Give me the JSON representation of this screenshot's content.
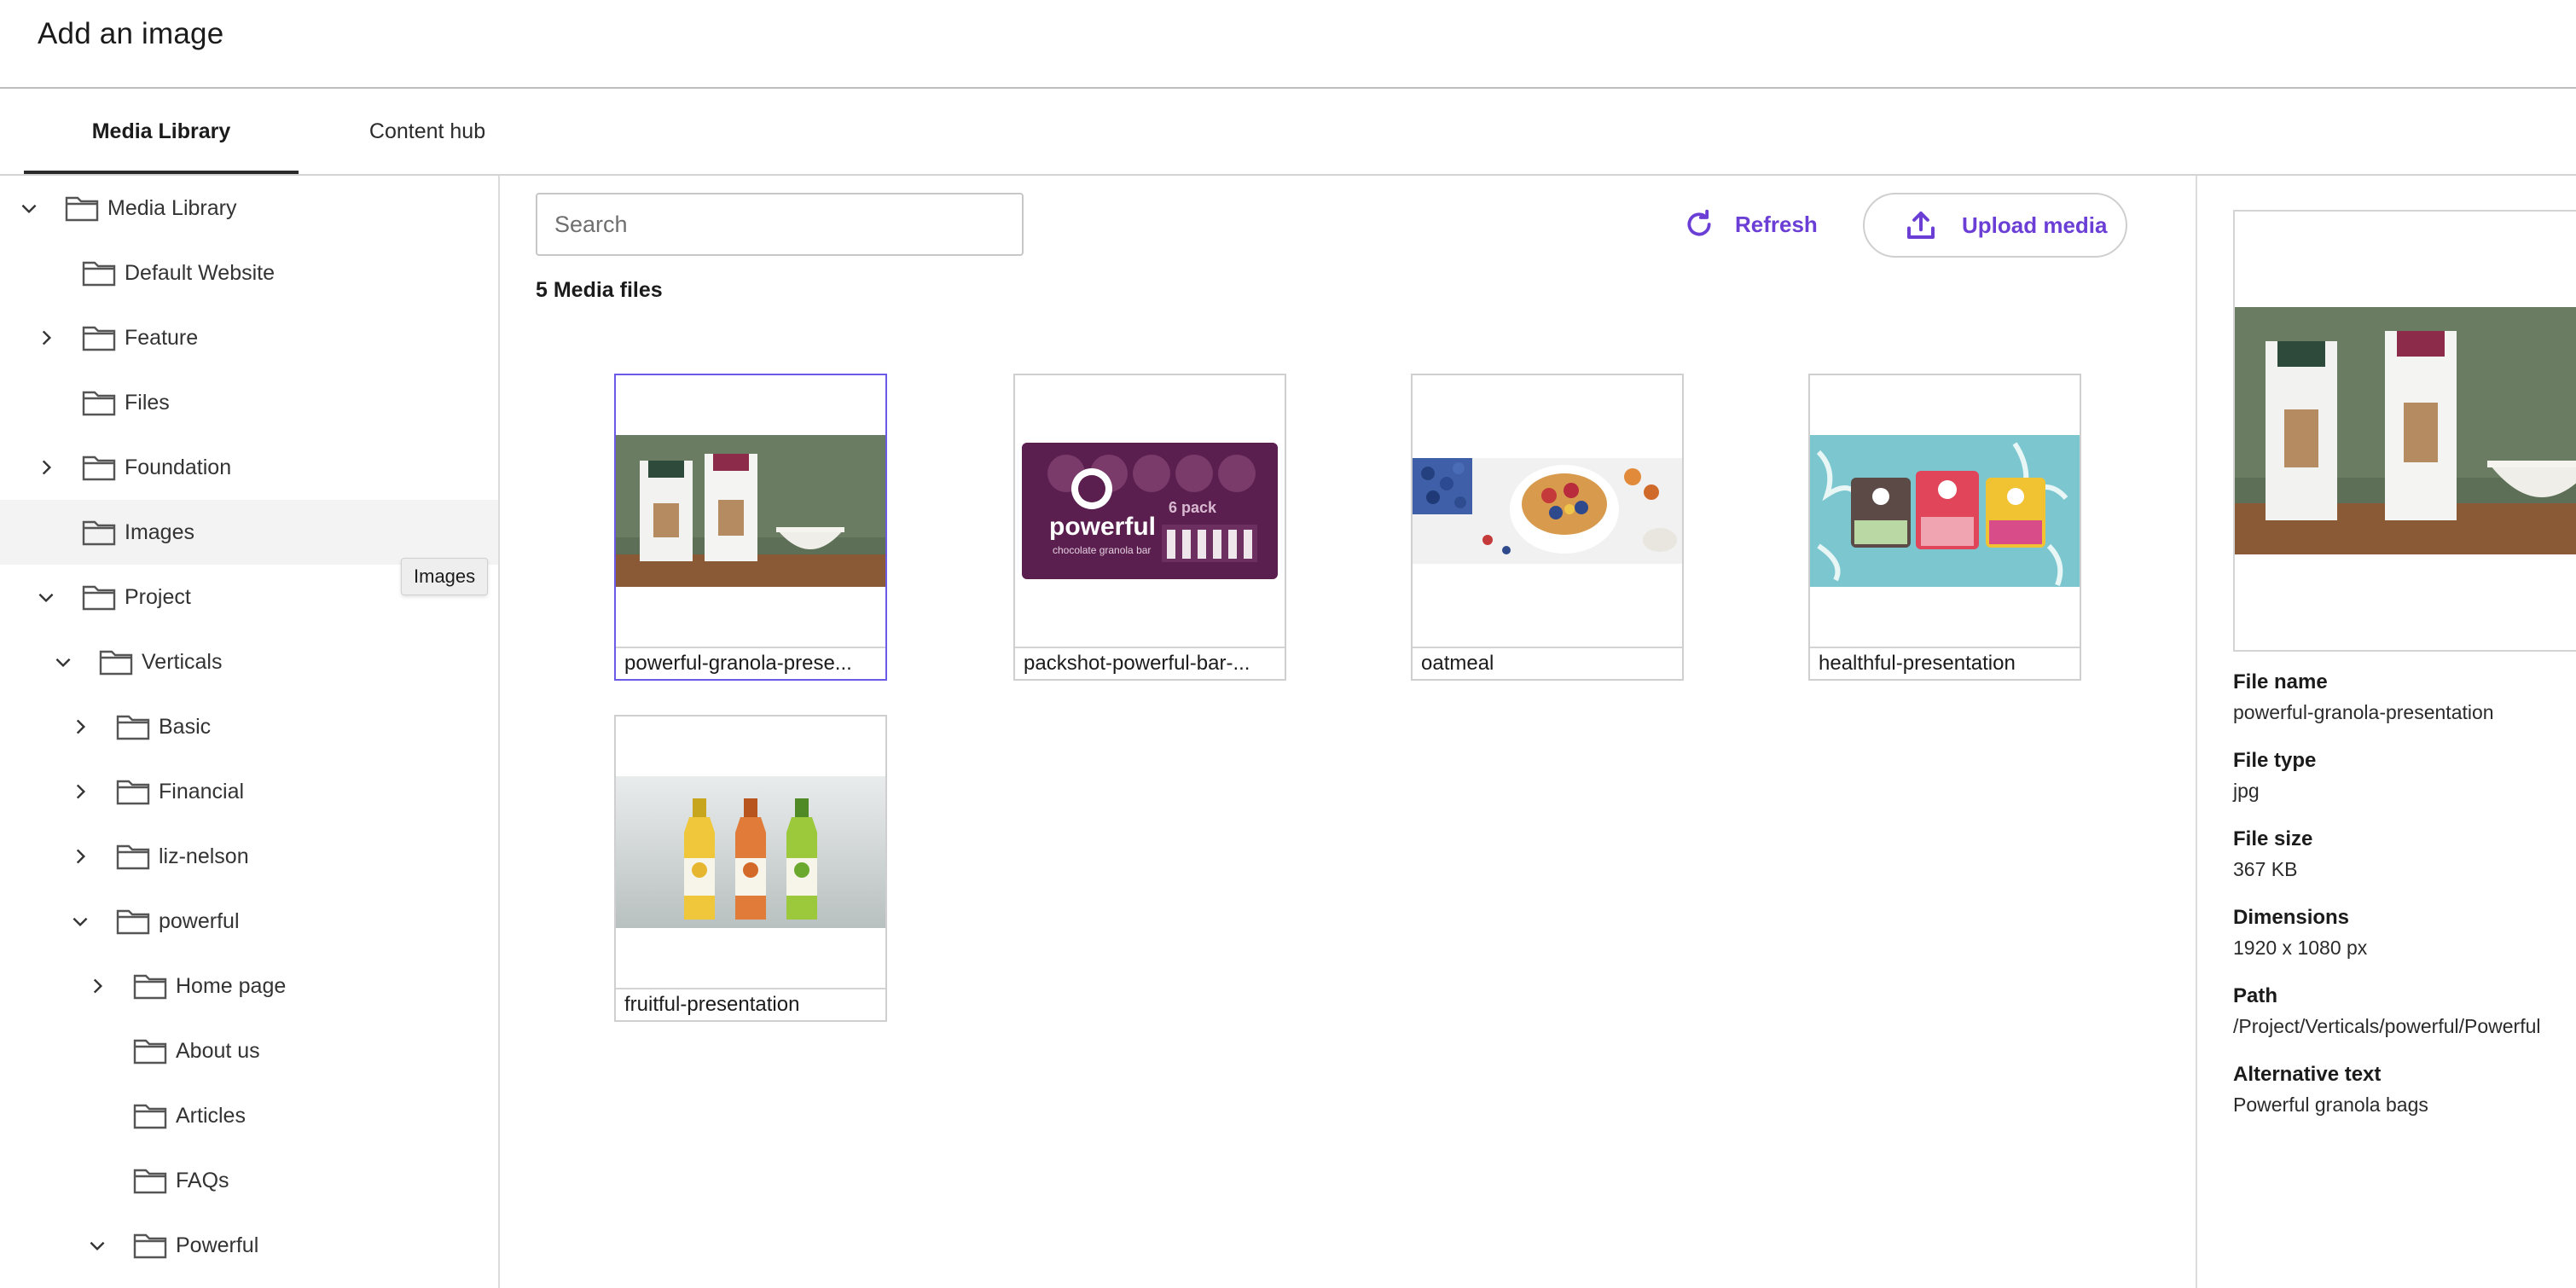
{
  "dialog": {
    "title": "Add an image"
  },
  "tabs": [
    {
      "label": "Media Library",
      "active": true
    },
    {
      "label": "Content hub",
      "active": false
    }
  ],
  "tree": [
    {
      "label": "Media Library",
      "expanded": true,
      "hasChildren": true
    },
    {
      "label": "Default Website",
      "hasChildren": false
    },
    {
      "label": "Feature",
      "expanded": false,
      "hasChildren": true
    },
    {
      "label": "Files",
      "hasChildren": false
    },
    {
      "label": "Foundation",
      "expanded": false,
      "hasChildren": true
    },
    {
      "label": "Images",
      "hasChildren": false,
      "selected": true
    },
    {
      "label": "Project",
      "expanded": true,
      "hasChildren": true
    },
    {
      "label": "Verticals",
      "expanded": true,
      "hasChildren": true
    },
    {
      "label": "Basic",
      "expanded": false,
      "hasChildren": true
    },
    {
      "label": "Financial",
      "expanded": false,
      "hasChildren": true
    },
    {
      "label": "liz-nelson",
      "expanded": false,
      "hasChildren": true
    },
    {
      "label": "powerful",
      "expanded": true,
      "hasChildren": true
    },
    {
      "label": "Home page",
      "expanded": false,
      "hasChildren": true
    },
    {
      "label": "About us",
      "hasChildren": false
    },
    {
      "label": "Articles",
      "hasChildren": false
    },
    {
      "label": "FAQs",
      "hasChildren": false
    },
    {
      "label": "Powerful",
      "expanded": true,
      "hasChildren": true
    }
  ],
  "tooltip": {
    "text": "Images"
  },
  "toolbar": {
    "search_placeholder": "Search",
    "refresh_label": "Refresh",
    "upload_label": "Upload media"
  },
  "media": {
    "count_label": "5 Media files",
    "items": [
      {
        "name": "powerful-granola-prese...",
        "selected": true
      },
      {
        "name": "packshot-powerful-bar-...",
        "selected": false
      },
      {
        "name": "oatmeal",
        "selected": false
      },
      {
        "name": "healthful-presentation",
        "selected": false
      },
      {
        "name": "fruitful-presentation",
        "selected": false
      }
    ]
  },
  "details": {
    "file_name_label": "File name",
    "file_name": "powerful-granola-presentation",
    "file_type_label": "File type",
    "file_type": "jpg",
    "file_size_label": "File size",
    "file_size": "367 KB",
    "dimensions_label": "Dimensions",
    "dimensions": "1920 x 1080 px",
    "path_label": "Path",
    "path": "/Project/Verticals/powerful/Powerful",
    "alt_label": "Alternative text",
    "alt": "Powerful granola bags"
  },
  "colors": {
    "accent": "#6b3fd6",
    "selection_border": "#6b5ae6",
    "thumb_teal": "#7cc7cf",
    "bar_purple": "#5a1f4e"
  },
  "icons": [
    "chevron-down-icon",
    "chevron-right-icon",
    "folder-icon",
    "refresh-icon",
    "upload-icon"
  ]
}
